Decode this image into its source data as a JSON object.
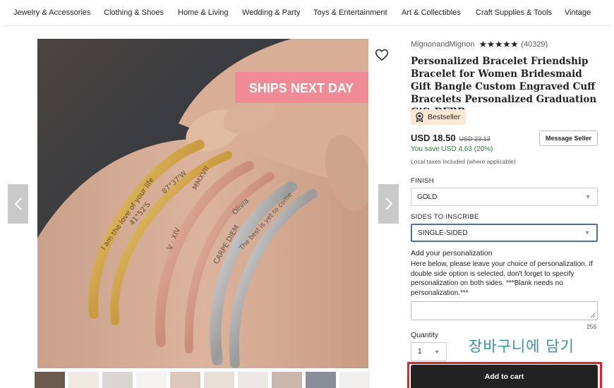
{
  "nav": {
    "items": [
      "Jewelry & Accessories",
      "Clothing & Shoes",
      "Home & Living",
      "Wedding & Party",
      "Toys & Entertainment",
      "Art & Collectibles",
      "Craft Supplies & Tools",
      "Vintage"
    ]
  },
  "gallery": {
    "overlay_text": "SHIPS NEXT DAY",
    "overlay_bg": "#f08a94",
    "engravings": [
      "I am the love of your life",
      "41°52'S",
      "87°37'W",
      "MMXVII",
      "V · XIV",
      "Olivia",
      "CARPE DIEM",
      "The best is yet to come"
    ]
  },
  "product": {
    "shop_name": "MignonandMignon",
    "rating_stars": "★★★★★",
    "review_count": "(40329)",
    "title": "Personalized Bracelet Friendship Bracelet for Women Bridesmaid Gift Bangle Custom Engraved Cuff Bracelets Personalized Graduation Gift DFBR",
    "badge": "Bestseller",
    "price": "USD 18.50",
    "original_price": "USD 23.13",
    "savings": "You save USD 4.63 (20%)",
    "tax_note": "Local taxes included (where applicable)",
    "message_seller": "Message Seller"
  },
  "options": {
    "finish_label": "FINISH",
    "finish_value": "GOLD",
    "sides_label": "SIDES TO INSCRIBE",
    "sides_value": "SINGLE-SIDED"
  },
  "personalization": {
    "title": "Add your personalization",
    "description": "Here below, please leave your choice of personalization. If double side option is selected, don't forget to specify personalization on both sides. ***Blank needs no personalization.***",
    "counter": "256"
  },
  "quantity": {
    "label": "Quantity",
    "value": "1"
  },
  "cart": {
    "korean_label": "장바구니에 담기",
    "button_label": "Add to cart"
  },
  "colors": {
    "badge_bg": "#fbe9d6",
    "savings_green": "#258635",
    "annotation_red": "#e0202a",
    "annotation_text": "#3c8fa6"
  }
}
